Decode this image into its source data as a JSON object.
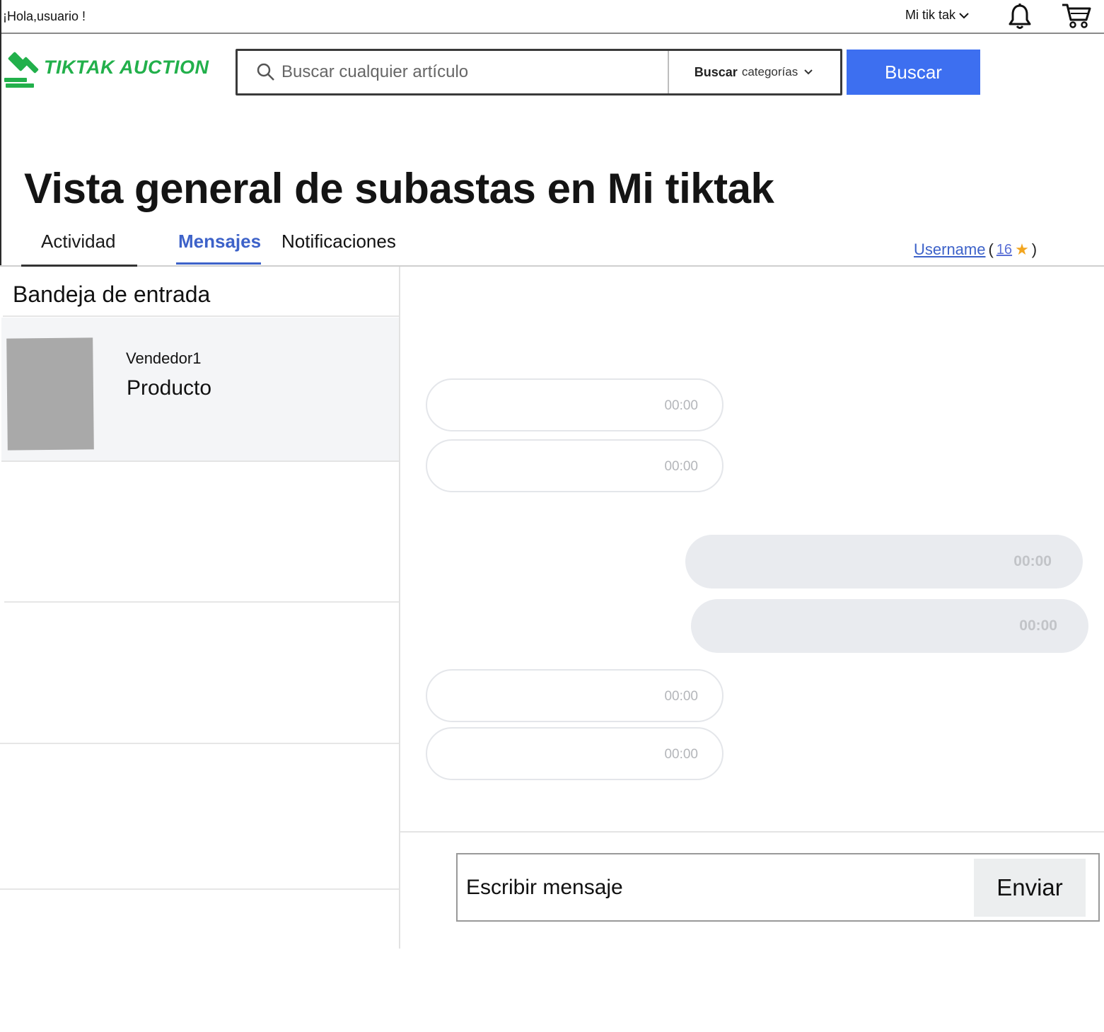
{
  "topbar": {
    "greeting": "¡Hola,usuario !",
    "my_menu_label": "Mi tik tak",
    "icons": [
      "chevron-down-icon",
      "bell-icon",
      "cart-icon"
    ]
  },
  "brand": {
    "logo_text": "TIKTAK AUCTION",
    "logo_icon": "gavel-icon",
    "color": "#22b04b"
  },
  "search": {
    "placeholder": "Buscar cualquier artículo",
    "category_bold": "Buscar",
    "category_light": "categorías",
    "button_label": "Buscar",
    "button_color": "#3d6ff0"
  },
  "page": {
    "title": "Vista general de subastas en Mi tiktak"
  },
  "tabs": [
    {
      "label": "Actividad"
    },
    {
      "label": "Mensajes",
      "active": true
    },
    {
      "label": "Notificaciones"
    }
  ],
  "user": {
    "username": "Username",
    "open_paren": "(",
    "rating": "16",
    "close_paren": ")"
  },
  "inbox": {
    "title": "Bandeja de entrada",
    "conversations": [
      {
        "seller": "Vendedor1",
        "product": "Producto"
      }
    ]
  },
  "chat": {
    "messages": [
      {
        "direction": "in",
        "time": "00:00"
      },
      {
        "direction": "in",
        "time": "00:00"
      },
      {
        "direction": "out",
        "time": "00:00"
      },
      {
        "direction": "out",
        "time": "00:00"
      },
      {
        "direction": "in",
        "time": "00:00"
      },
      {
        "direction": "in",
        "time": "00:00"
      }
    ],
    "compose_placeholder": "Escribir mensaje",
    "send_label": "Enviar"
  },
  "colors": {
    "accent": "#3d62c9",
    "star": "#f2a51f"
  }
}
